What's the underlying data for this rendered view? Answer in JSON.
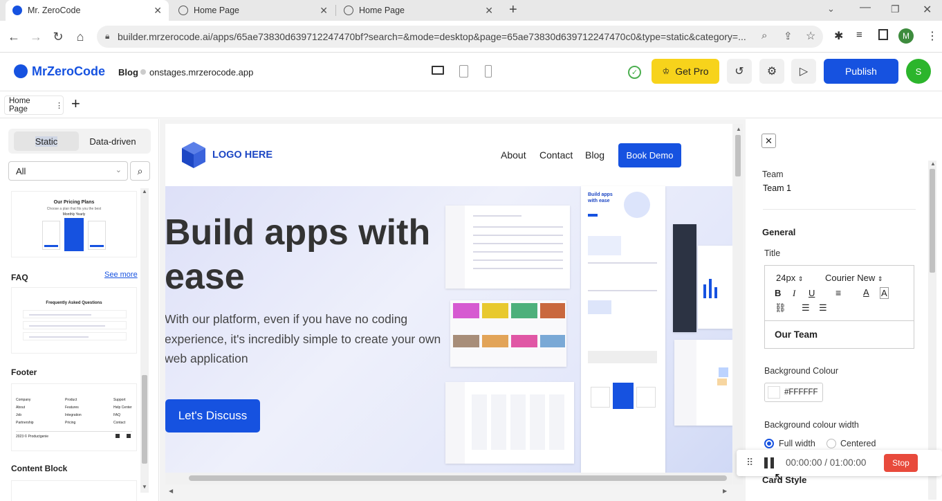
{
  "browser": {
    "tabs": [
      {
        "title": "Mr. ZeroCode"
      },
      {
        "title": "Home Page"
      },
      {
        "title": "Home Page"
      }
    ],
    "url": "builder.mrzerocode.ai/apps/65ae73830d639712247470bf?search=&mode=desktop&page=65ae73830d639712247470c0&type=static&category=...",
    "profile_initial": "M"
  },
  "header": {
    "brand": "MrZeroCode",
    "app_name": "Blog",
    "domain": "onstages.mrzerocode.app",
    "get_pro": "Get Pro",
    "publish": "Publish",
    "avatar_initial": "S"
  },
  "pagebar": {
    "page_tab": "Home Page",
    "menu_dots": "⋮",
    "add": "+"
  },
  "left": {
    "seg_static": "Static",
    "seg_data": "Data-driven",
    "filter_value": "All",
    "pricing_title": "Our Pricing Plans",
    "pricing_sub": "Choose a plan that fits you the best",
    "pricing_toggle": "Monthly  Yearly",
    "faq_label": "FAQ",
    "see_more": "See more",
    "faq_thumb_title": "Frequently Asked Questions",
    "footer_label": "Footer",
    "footer_cols": [
      "Company",
      "Product",
      "Support"
    ],
    "footer_col1": [
      "About",
      "Job",
      "Partnership"
    ],
    "footer_col2": [
      "Features",
      "Integration",
      "Pricing"
    ],
    "footer_col3": [
      "Help Center",
      "FAQ",
      "Contact"
    ],
    "footer_copy": "2023 © Productgenie",
    "content_block_label": "Content Block"
  },
  "canvas": {
    "logo_text": "LOGO HERE",
    "nav": [
      "About",
      "Contact",
      "Blog"
    ],
    "book_demo": "Book Demo",
    "hero_title": "Build apps with ease",
    "hero_body": "With our platform, even if you have no coding experience, it's incredibly simple to create your own web application",
    "cta": "Let's Discuss",
    "mini_title": "Build apps with ease"
  },
  "right": {
    "team_label": "Team",
    "team_value": "Team 1",
    "general": "General",
    "title_label": "Title",
    "font_size": "24px",
    "font_family": "Courier New",
    "title_text": "Our Team",
    "bg_colour_label": "Background Colour",
    "bg_colour_value": "#FFFFFF",
    "bg_width_label": "Background colour width",
    "opt_full": "Full width",
    "opt_centered": "Centered",
    "card_style": "Card Style"
  },
  "recorder": {
    "time": "00:00:00 / 01:00:00",
    "stop": "Stop"
  },
  "colors": {
    "primary": "#1652e0",
    "get_pro_bg": "#f7d31b",
    "avatar_bg": "#2cb52c",
    "stop_bg": "#e84a3c"
  }
}
